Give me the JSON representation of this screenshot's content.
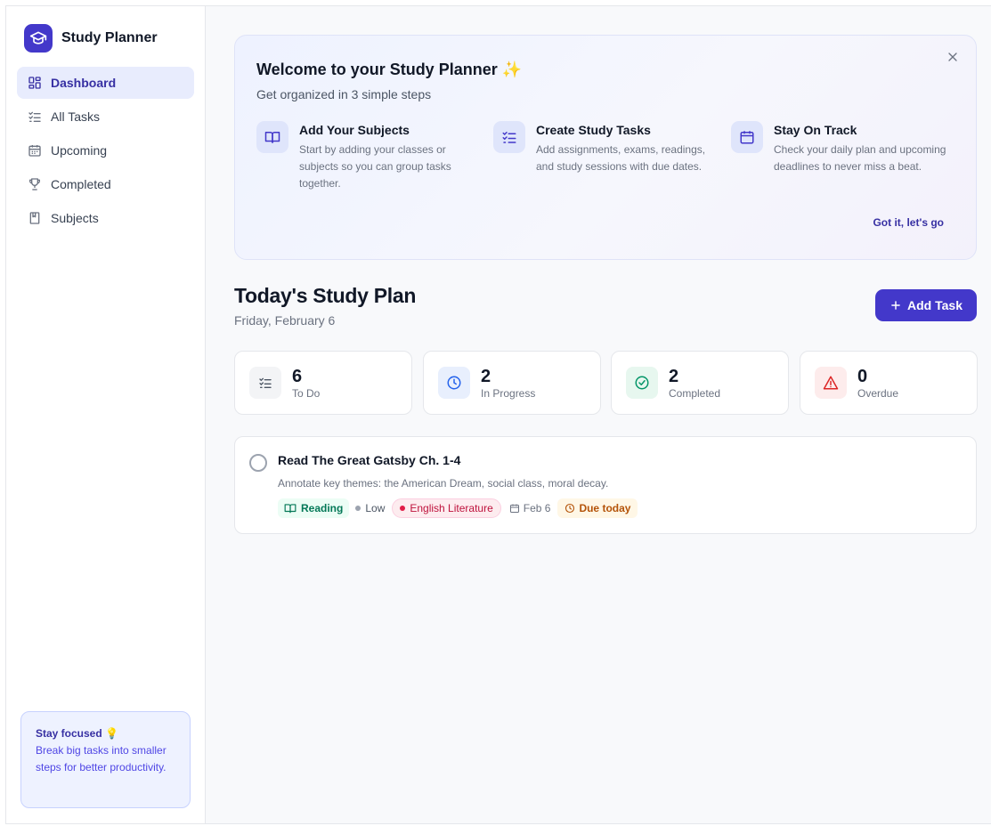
{
  "app": {
    "name": "Study Planner"
  },
  "sidebar": {
    "items": [
      {
        "label": "Dashboard",
        "icon": "dashboard-icon",
        "active": true
      },
      {
        "label": "All Tasks",
        "icon": "list-check-icon"
      },
      {
        "label": "Upcoming",
        "icon": "calendar-icon"
      },
      {
        "label": "Completed",
        "icon": "trophy-icon"
      },
      {
        "label": "Subjects",
        "icon": "notebook-icon"
      }
    ],
    "tip": {
      "title": "Stay focused 💡",
      "text": "Break big tasks into smaller steps for better productivity."
    }
  },
  "welcome": {
    "title": "Welcome to your Study Planner ✨",
    "subtitle": "Get organized in 3 simple steps",
    "steps": [
      {
        "title": "Add Your Subjects",
        "desc": "Start by adding your classes or subjects so you can group tasks together.",
        "icon": "book-open-icon"
      },
      {
        "title": "Create Study Tasks",
        "desc": "Add assignments, exams, readings, and study sessions with due dates.",
        "icon": "list-check-icon"
      },
      {
        "title": "Stay On Track",
        "desc": "Check your daily plan and upcoming deadlines to never miss a beat.",
        "icon": "calendar-icon"
      }
    ],
    "cta": "Got it, let's go"
  },
  "plan": {
    "title": "Today's Study Plan",
    "date": "Friday, February 6",
    "add_button": "Add Task"
  },
  "stats": [
    {
      "value": "6",
      "label": "To Do",
      "icon": "list-check-icon",
      "color": "#4b5563",
      "bg": "#f3f4f6"
    },
    {
      "value": "2",
      "label": "In Progress",
      "icon": "clock-icon",
      "color": "#2563eb",
      "bg": "#e8effd"
    },
    {
      "value": "2",
      "label": "Completed",
      "icon": "check-circle-icon",
      "color": "#059669",
      "bg": "#e7f7ef"
    },
    {
      "value": "0",
      "label": "Overdue",
      "icon": "warning-icon",
      "color": "#dc2626",
      "bg": "#fdecec"
    }
  ],
  "tasks": [
    {
      "title": "Read The Great Gatsby Ch. 1-4",
      "description": "Annotate key themes: the American Dream, social class, moral decay.",
      "type": "Reading",
      "priority": "Low",
      "subject": "English Literature",
      "date": "Feb 6",
      "due": "Due today"
    }
  ],
  "colors": {
    "accent": "#4338ca",
    "subject": "#e11d48",
    "priority_low": "#9ca3af"
  }
}
